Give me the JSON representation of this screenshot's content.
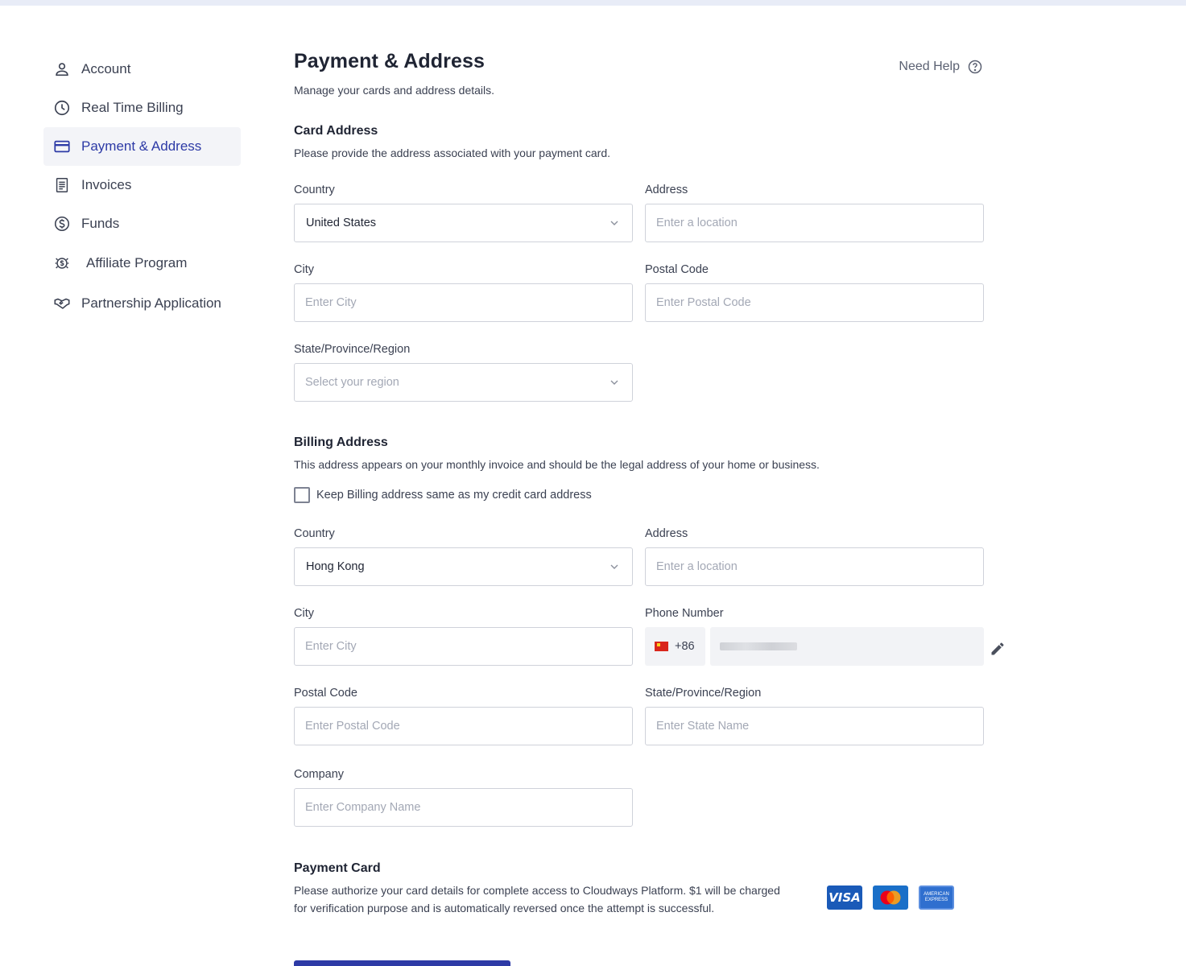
{
  "sidebar": {
    "items": [
      {
        "label": "Account",
        "icon": "user-icon"
      },
      {
        "label": "Real Time Billing",
        "icon": "clock-icon"
      },
      {
        "label": "Payment & Address",
        "icon": "credit-card-icon",
        "active": true
      },
      {
        "label": "Invoices",
        "icon": "invoice-icon"
      },
      {
        "label": "Funds",
        "icon": "dollar-circle-icon"
      },
      {
        "label": "Affiliate Program",
        "icon": "affiliate-icon"
      },
      {
        "label": "Partnership Application",
        "icon": "handshake-icon"
      }
    ]
  },
  "header": {
    "title": "Payment & Address",
    "subtitle": "Manage your cards and address details.",
    "help_label": "Need Help"
  },
  "card_address": {
    "title": "Card Address",
    "description": "Please provide the address associated with your payment card.",
    "country_label": "Country",
    "country_value": "United States",
    "address_label": "Address",
    "address_placeholder": "Enter a location",
    "city_label": "City",
    "city_placeholder": "Enter City",
    "postal_label": "Postal Code",
    "postal_placeholder": "Enter Postal Code",
    "region_label": "State/Province/Region",
    "region_placeholder": "Select your region"
  },
  "billing_address": {
    "title": "Billing Address",
    "description": "This address appears on your monthly invoice and should be the legal address of your home or business.",
    "same_checkbox_label": "Keep Billing address same as my credit card address",
    "country_label": "Country",
    "country_value": "Hong Kong",
    "address_label": "Address",
    "address_placeholder": "Enter a location",
    "city_label": "City",
    "city_placeholder": "Enter City",
    "phone_label": "Phone Number",
    "phone_code": "+86",
    "postal_label": "Postal Code",
    "postal_placeholder": "Enter Postal Code",
    "state_label": "State/Province/Region",
    "state_placeholder": "Enter State Name",
    "company_label": "Company",
    "company_placeholder": "Enter Company Name"
  },
  "payment_card": {
    "title": "Payment Card",
    "description": "Please authorize your card details for complete access to Cloudways Platform. $1 will be charged for verification purpose and is automatically reversed once the attempt is successful.",
    "visa_label": "VISA",
    "amex_label": "AMERICAN EXPRESS"
  },
  "colors": {
    "accent": "#2d3aa6",
    "active_bg": "#f3f4f8",
    "border": "#cfd2da"
  }
}
